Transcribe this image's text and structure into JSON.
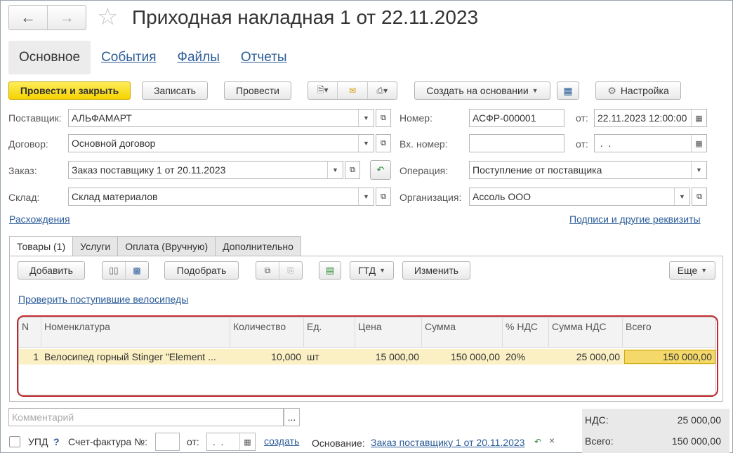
{
  "window": {
    "title": "Приходная накладная 1 от 22.11.2023",
    "nav_back_icon": "arrow-left-icon",
    "nav_forward_icon": "arrow-right-icon",
    "favorite_icon": "star-icon"
  },
  "top_tabs": [
    {
      "label": "Основное",
      "active": true
    },
    {
      "label": "События"
    },
    {
      "label": "Файлы"
    },
    {
      "label": "Отчеты"
    }
  ],
  "toolbar": {
    "post_close": "Провести и закрыть",
    "save": "Записать",
    "post": "Провести",
    "create_based": "Создать на основании",
    "settings": "Настройка"
  },
  "form": {
    "supplier_label": "Поставщик:",
    "supplier_value": "АЛЬФАМАРТ",
    "contract_label": "Договор:",
    "contract_value": "Основной договор",
    "order_label": "Заказ:",
    "order_value": "Заказ поставщику 1 от 20.11.2023",
    "warehouse_label": "Склад:",
    "warehouse_value": "Склад материалов",
    "number_label": "Номер:",
    "number_value": "АСФР-000001",
    "date_from_label": "от:",
    "date_value": "22.11.2023 12:00:00",
    "in_number_label": "Вх. номер:",
    "in_number_value": "",
    "in_date_label": "от:",
    "in_date_value": " .  .",
    "operation_label": "Операция:",
    "operation_value": "Поступление от поставщика",
    "org_label": "Организация:",
    "org_value": "Ассоль ООО",
    "discrepancies_link": "Расхождения",
    "signatures_link": "Подписи и другие реквизиты"
  },
  "inner_tabs": [
    {
      "label": "Товары (1)",
      "active": true
    },
    {
      "label": "Услуги"
    },
    {
      "label": "Оплата (Вручную)"
    },
    {
      "label": "Дополнительно"
    }
  ],
  "goods_toolbar": {
    "add": "Добавить",
    "pick": "Подобрать",
    "gtd": "ГТД",
    "change": "Изменить",
    "more": "Еще",
    "check_link": "Проверить поступившие велосипеды"
  },
  "table": {
    "columns": [
      "N",
      "Номенклатура",
      "Количество",
      "Ед.",
      "Цена",
      "Сумма",
      "% НДС",
      "Сумма НДС",
      "Всего"
    ],
    "rows": [
      {
        "n": "1",
        "item": "Велосипед горный Stinger \"Element ...",
        "qty": "10,000",
        "unit": "шт",
        "price": "15 000,00",
        "sum": "150 000,00",
        "vat_rate": "20%",
        "vat_sum": "25 000,00",
        "total": "150 000,00"
      }
    ]
  },
  "bottom": {
    "comment_placeholder": "Комментарий",
    "comment_btn": "...",
    "upd_label": "УПД",
    "help": "?",
    "invoice_label": "Счет-фактура №:",
    "invoice_from": "от:",
    "invoice_date": " .  .",
    "create_link": "создать",
    "basis_label": "Основание:",
    "basis_link": "Заказ поставщику 1 от 20.11.2023",
    "clear": "×"
  },
  "totals": {
    "vat_label": "НДС:",
    "vat_value": "25 000,00",
    "total_label": "Всего:",
    "total_value": "150 000,00"
  },
  "colors": {
    "accent_yellow": "#f5d400",
    "link_blue": "#2b5c98",
    "highlight_row": "#fbf0c3",
    "red_annotation": "#c0282d"
  }
}
